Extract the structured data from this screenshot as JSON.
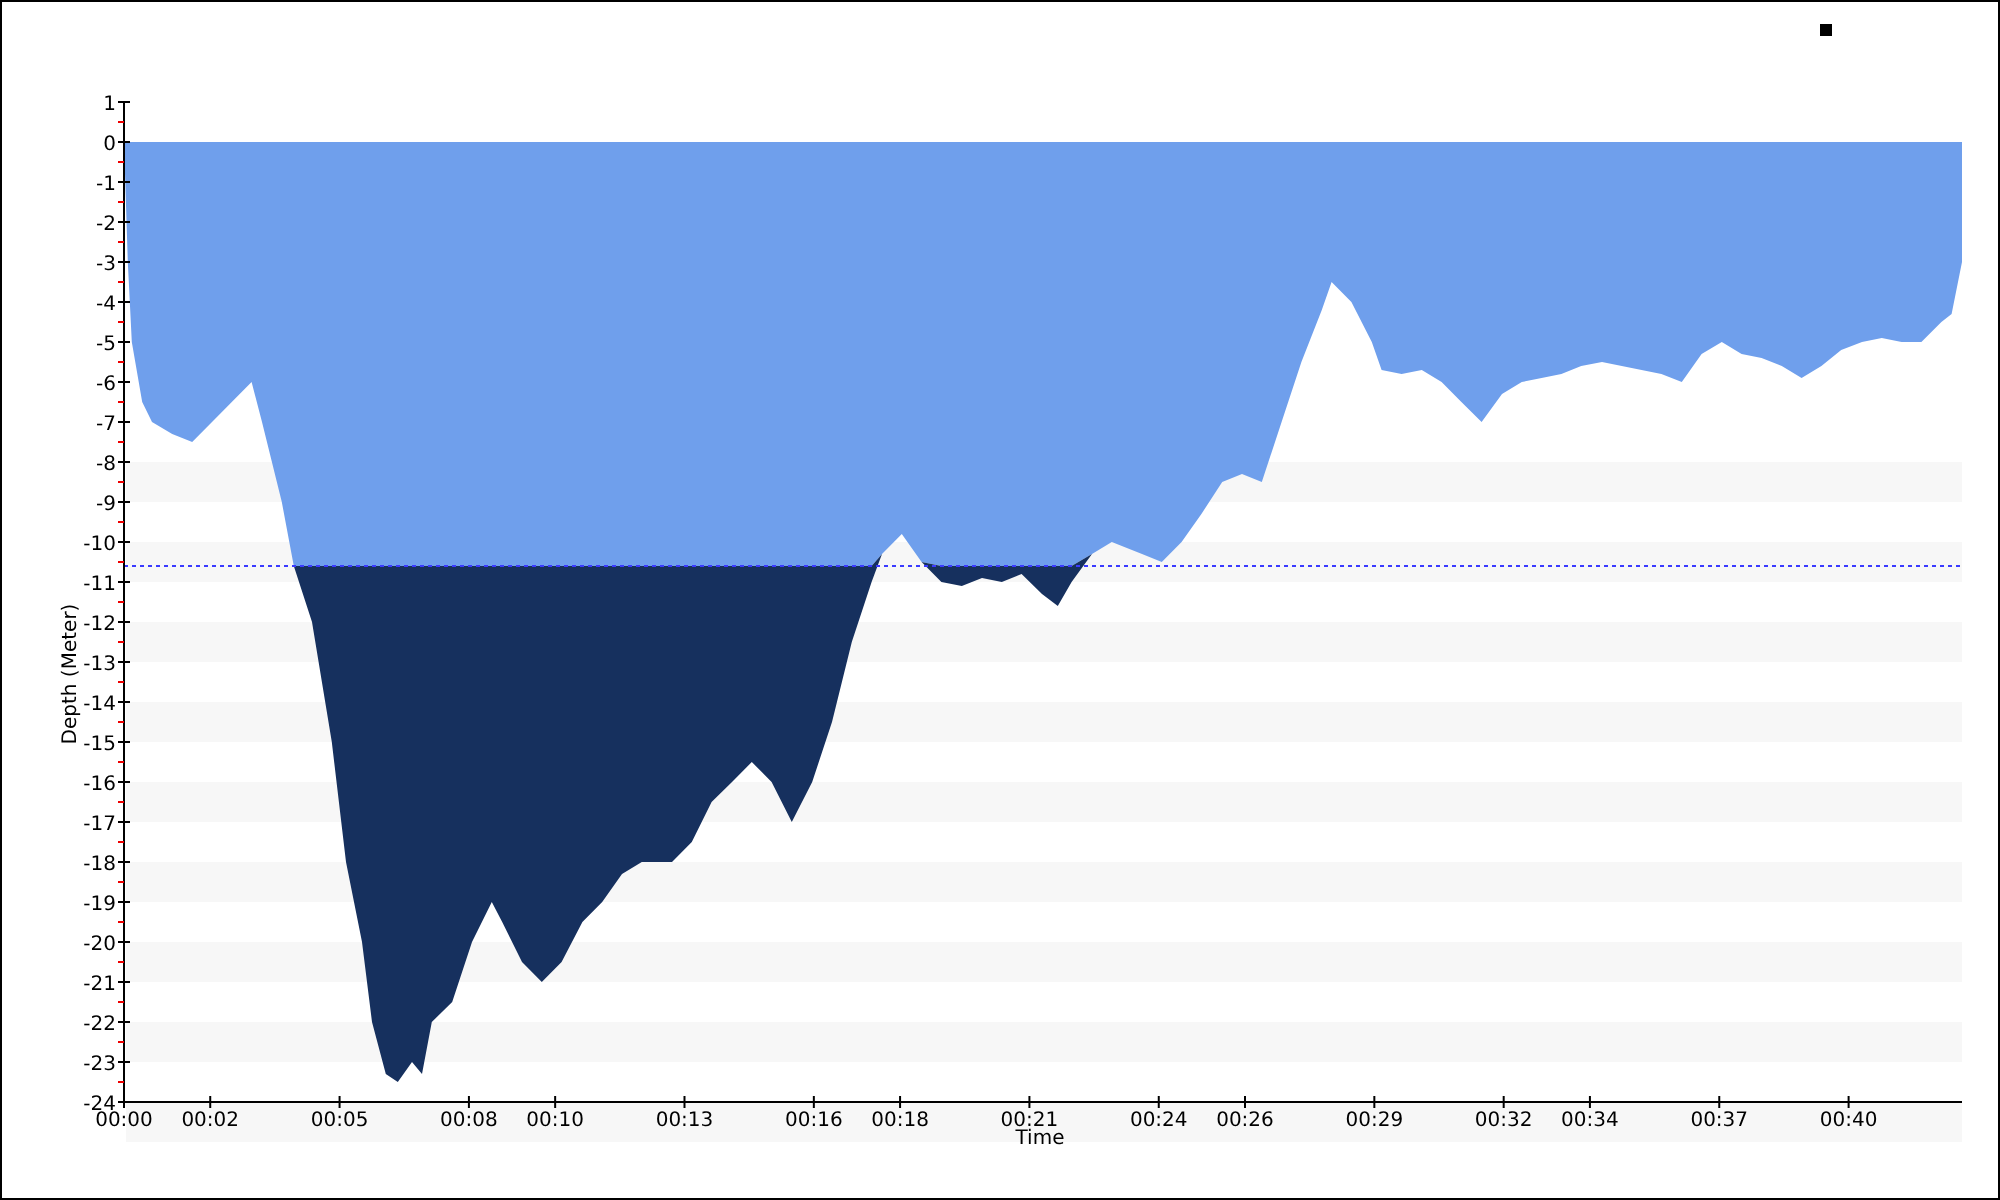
{
  "chart": {
    "chart_data": {
      "type": "area",
      "xlabel": "Time",
      "ylabel": "Depth (Meter)",
      "x": [
        0,
        0.09,
        0.18,
        0.42,
        0.65,
        1.12,
        1.58,
        2.04,
        2.5,
        2.96,
        3.2,
        3.66,
        3.94,
        4.36,
        4.82,
        5.15,
        5.52,
        5.75,
        6.07,
        6.35,
        6.68,
        6.91,
        7.14,
        7.61,
        8.07,
        8.53,
        8.77,
        9.23,
        9.69,
        10.15,
        10.63,
        11.09,
        11.55,
        12.01,
        12.71,
        13.17,
        13.63,
        14.1,
        14.56,
        15.02,
        15.49,
        15.96,
        16.42,
        16.88,
        17.34,
        17.58,
        18.04,
        18.5,
        18.96,
        19.43,
        19.9,
        20.36,
        20.82,
        21.29,
        21.66,
        21.98,
        22.45,
        22.91,
        23.61,
        24.07,
        24.53,
        24.99,
        25.47,
        25.93,
        26.39,
        26.85,
        27.31,
        27.78,
        28.01,
        28.47,
        28.94,
        29.17,
        29.63,
        30.1,
        30.56,
        31.02,
        31.49,
        31.96,
        32.42,
        32.88,
        33.34,
        33.8,
        34.28,
        34.74,
        35.2,
        35.66,
        36.13,
        36.59,
        37.06,
        37.52,
        37.98,
        38.45,
        38.91,
        39.37,
        39.83,
        40.31,
        40.77,
        41.23,
        41.69,
        42.15,
        42.39,
        42.63
      ],
      "series": [
        {
          "color": "#6f9fec",
          "values": [
            0,
            -3,
            -5,
            -6.5,
            -7,
            -7.3,
            -7.5,
            -7,
            -6.5,
            -6,
            -7,
            -9,
            -10.6,
            -10.6,
            -10.6,
            -10.6,
            -10.6,
            -10.6,
            -10.6,
            -10.6,
            -10.6,
            -10.6,
            -10.6,
            -10.6,
            -10.6,
            -10.6,
            -10.6,
            -10.6,
            -10.6,
            -10.6,
            -10.6,
            -10.6,
            -10.6,
            -10.6,
            -10.6,
            -10.6,
            -10.6,
            -10.6,
            -10.6,
            -10.6,
            -10.6,
            -10.6,
            -10.6,
            -10.6,
            -10.6,
            -10.3,
            -9.8,
            -10.5,
            -10.6,
            -10.6,
            -10.6,
            -10.6,
            -10.6,
            -10.6,
            -10.6,
            -10.6,
            -10.3,
            -10,
            -10.3,
            -10.5,
            -10,
            -9.3,
            -8.5,
            -8.3,
            -8.5,
            -7,
            -5.5,
            -4.2,
            -3.5,
            -4,
            -5,
            -5.7,
            -5.8,
            -5.7,
            -6,
            -6.5,
            -7,
            -6.3,
            -6,
            -5.9,
            -5.8,
            -5.6,
            -5.5,
            -5.6,
            -5.7,
            -5.8,
            -6,
            -5.3,
            -5,
            -5.3,
            -5.4,
            -5.6,
            -5.9,
            -5.6,
            -5.2,
            -5,
            -4.9,
            -5,
            -5,
            -4.5,
            -4.3,
            -3
          ]
        },
        {
          "color": "#16305e",
          "values": [
            0,
            0,
            0,
            0,
            0,
            0,
            0,
            0,
            0,
            0,
            0,
            0,
            0,
            -1.4,
            -4.4,
            -7.4,
            -9.4,
            -11.4,
            -12.7,
            -12.9,
            -12.4,
            -12.7,
            -11.4,
            -10.9,
            -9.4,
            -8.4,
            -8.9,
            -9.9,
            -10.4,
            -9.9,
            -8.9,
            -8.4,
            -7.7,
            -7.4,
            -7.4,
            -6.9,
            -5.9,
            -5.4,
            -4.9,
            -5.4,
            -6.4,
            -5.4,
            -3.9,
            -1.9,
            -0.4,
            0,
            0,
            0,
            -0.4,
            -0.5,
            -0.3,
            -0.4,
            -0.2,
            -0.7,
            -1.0,
            -0.4,
            0,
            0,
            0,
            0,
            0,
            0,
            0,
            0,
            0,
            0,
            0,
            0,
            0,
            0,
            0,
            0,
            0,
            0,
            0,
            0,
            0,
            0,
            0,
            0,
            0,
            0,
            0,
            0,
            0,
            0,
            0,
            0,
            0,
            0,
            0,
            0,
            0,
            0,
            0,
            0,
            0,
            0,
            0,
            0,
            0,
            0
          ]
        }
      ],
      "stacked": true,
      "xlim": [
        0,
        42.63
      ],
      "ylim": [
        -24,
        1
      ],
      "xticks": [
        {
          "value": 0,
          "label": "00:00"
        },
        {
          "value": 2,
          "label": "00:02"
        },
        {
          "value": 5,
          "label": "00:05"
        },
        {
          "value": 8,
          "label": "00:08"
        },
        {
          "value": 10,
          "label": "00:10"
        },
        {
          "value": 13,
          "label": "00:13"
        },
        {
          "value": 16,
          "label": "00:16"
        },
        {
          "value": 18,
          "label": "00:18"
        },
        {
          "value": 21,
          "label": "00:21"
        },
        {
          "value": 24,
          "label": "00:24"
        },
        {
          "value": 26,
          "label": "00:26"
        },
        {
          "value": 29,
          "label": "00:29"
        },
        {
          "value": 32,
          "label": "00:32"
        },
        {
          "value": 34,
          "label": "00:34"
        },
        {
          "value": 37,
          "label": "00:37"
        },
        {
          "value": 40,
          "label": "00:40"
        }
      ],
      "yticks": [
        1,
        0,
        -1,
        -2,
        -3,
        -4,
        -5,
        -6,
        -7,
        -8,
        -9,
        -10,
        -11,
        -12,
        -13,
        -14,
        -15,
        -16,
        -17,
        -18,
        -19,
        -20,
        -21,
        -22,
        -23,
        -24
      ],
      "ref_lines": [
        {
          "axis": "y",
          "value": -10.6,
          "color": "#3a3aff"
        }
      ]
    }
  }
}
